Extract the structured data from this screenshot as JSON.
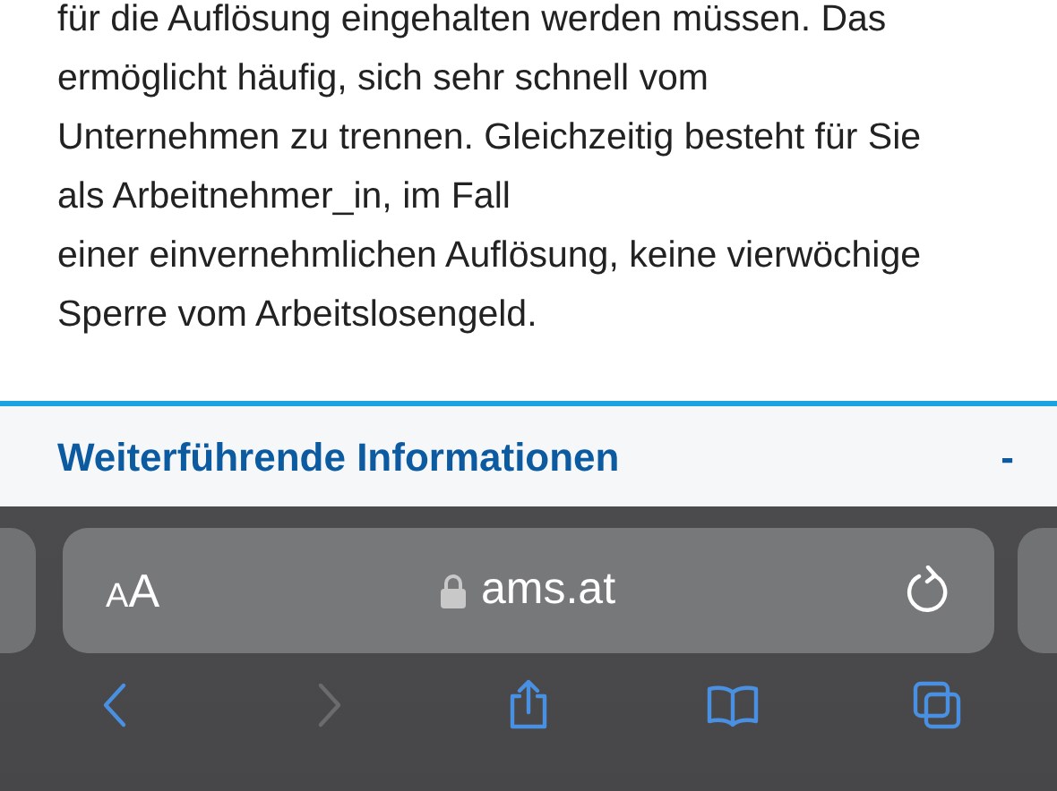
{
  "article": {
    "paragraph_lines": [
      "für die Auflösung eingehalten werden müssen. Das",
      "ermöglicht häufig, sich sehr schnell vom",
      "Unternehmen zu trennen. Gleichzeitig besteht für Sie",
      "als Arbeitnehmer_in, im Fall",
      "einer einvernehmlichen Auflösung, keine vierwöchige",
      "Sperre vom Arbeitslosengeld."
    ]
  },
  "accordion": {
    "title": "Weiterführende Informationen",
    "toggle": "-"
  },
  "address_bar": {
    "text_size_button": "AA",
    "url": "ams.at",
    "secure": true
  },
  "toolbar": [
    {
      "kind": "back",
      "disabled": false
    },
    {
      "kind": "forward",
      "disabled": true
    },
    {
      "kind": "share",
      "disabled": false
    },
    {
      "kind": "bookmarks",
      "disabled": false
    },
    {
      "kind": "tabs",
      "disabled": false
    }
  ]
}
